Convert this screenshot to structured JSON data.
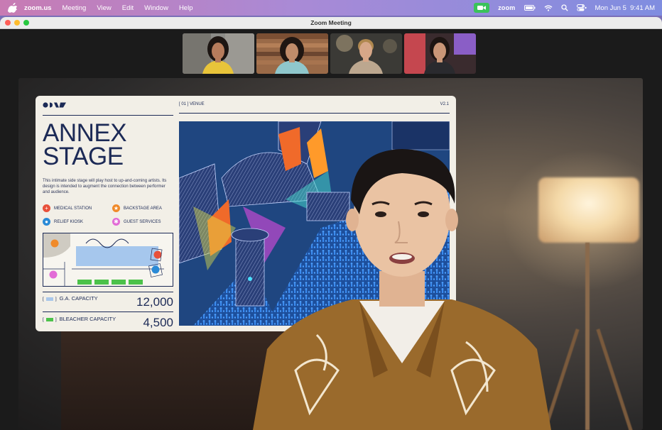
{
  "menubar": {
    "app_name": "zoom.us",
    "items": [
      "Meeting",
      "View",
      "Edit",
      "Window",
      "Help"
    ],
    "zoom_label": "zoom",
    "datetime": "Mon Jun 5  9:41 AM"
  },
  "window": {
    "title": "Zoom Meeting"
  },
  "slide": {
    "section": "[ 01 ] VENUE",
    "version": "V2.1",
    "title": "ANNEX\nSTAGE",
    "description": "This intimate side stage will play host to up-and-coming artists. Its design is intended to augment the connection between performer and audience.",
    "legend": [
      {
        "label": "MEDICAL STATION",
        "color": "#e8503a",
        "icon": "plus-icon"
      },
      {
        "label": "BACKSTAGE AREA",
        "color": "#f08a2a",
        "icon": "star-icon"
      },
      {
        "label": "RELIEF KIOSK",
        "color": "#2a8ad6",
        "icon": "drop-icon"
      },
      {
        "label": "GUEST SERVICES",
        "color": "#e26bd6",
        "icon": "asterisk-icon"
      }
    ],
    "capacities": [
      {
        "tag_open": "[",
        "tag_close": "]",
        "label": "G.A. CAPACITY",
        "value": "12,000",
        "swatch": "#a9c7ea"
      },
      {
        "tag_open": "[",
        "tag_close": "]",
        "label": "BLEACHER CAPACITY",
        "value": "4,500",
        "swatch": "#4cc24a"
      }
    ]
  },
  "colors": {
    "slide_navy": "#1c2a56",
    "stage_blue": "#1f4680",
    "crowd_blue": "#2b7be0"
  }
}
